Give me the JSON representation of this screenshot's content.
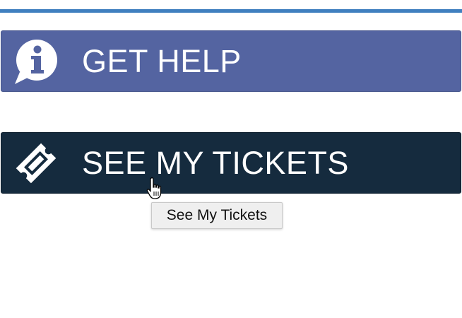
{
  "buttons": {
    "help": {
      "label": "GET HELP",
      "icon": "info-speech-bubble-icon",
      "color": "#5464a1"
    },
    "tickets": {
      "label": "SEE MY TICKETS",
      "icon": "ticket-icon",
      "color": "#152b3e"
    }
  },
  "tooltip": {
    "text": "See My Tickets"
  },
  "accent": {
    "top_rule_color": "#3f7fbf"
  },
  "cursor": {
    "icon": "hand-pointer-icon"
  }
}
